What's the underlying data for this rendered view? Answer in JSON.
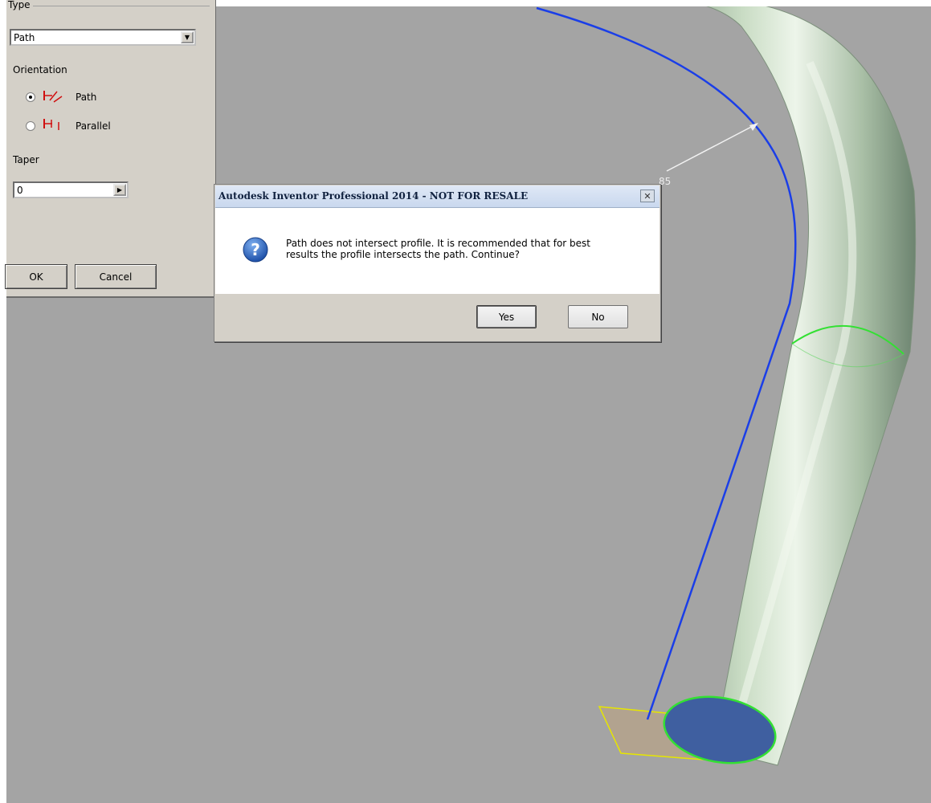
{
  "sweep_panel": {
    "type_label": "Type",
    "type_value": "Path",
    "orientation_label": "Orientation",
    "orientation_options": [
      {
        "label": "Path",
        "selected": true,
        "icon": "path-orientation-icon"
      },
      {
        "label": "Parallel",
        "selected": false,
        "icon": "parallel-orientation-icon"
      }
    ],
    "taper_label": "Taper",
    "taper_value": "0",
    "ok_label": "OK",
    "cancel_label": "Cancel"
  },
  "viewport": {
    "dimension_label": "85",
    "colors": {
      "background": "#a4a4a4",
      "path": "#1a3ee8",
      "tube": "#b9ccb4",
      "profile_outline": "#33e033",
      "sketch_plane": "#e6e600"
    }
  },
  "dialog": {
    "title": "Autodesk Inventor Professional 2014 - NOT FOR RESALE",
    "close_icon": "close-icon",
    "message_icon": "question-icon",
    "message": "Path does not intersect profile. It is recommended that for best results the profile intersects the path. Continue?",
    "yes_label": "Yes",
    "no_label": "No"
  }
}
